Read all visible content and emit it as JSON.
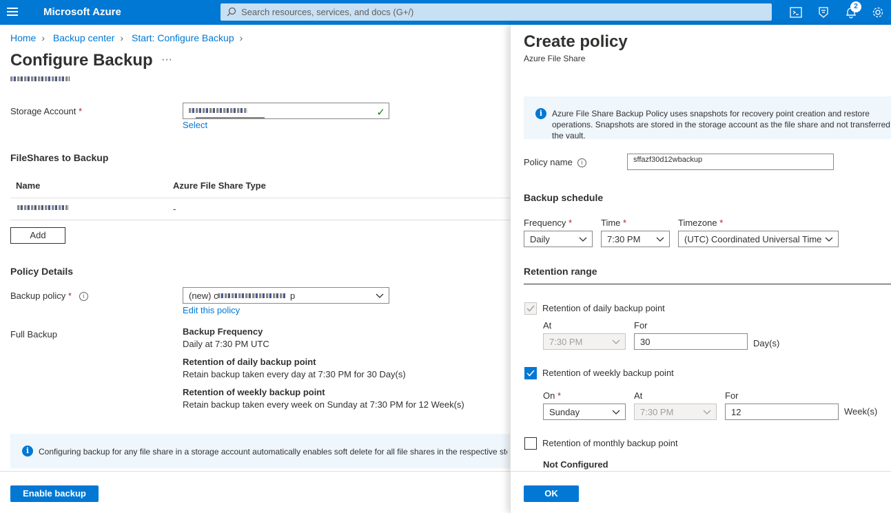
{
  "topbar": {
    "brand": "Microsoft Azure",
    "search_placeholder": "Search resources, services, and docs (G+/)",
    "notification_count": "2"
  },
  "breadcrumb": [
    "Home",
    "Backup center",
    "Start: Configure Backup"
  ],
  "page": {
    "title": "Configure Backup",
    "more": "···"
  },
  "storage": {
    "label": "Storage Account",
    "select_link": "Select"
  },
  "fileshares": {
    "heading": "FileShares to Backup",
    "col_name": "Name",
    "col_type": "Azure File Share Type",
    "row_type": "-",
    "add_button": "Add"
  },
  "policy": {
    "heading": "Policy Details",
    "label": "Backup policy",
    "value_prefix": "(new) c",
    "value_suffix": "p",
    "edit_link": "Edit this policy",
    "full_backup_label": "Full Backup",
    "details": [
      {
        "title": "Backup Frequency",
        "text": "Daily at 7:30 PM UTC"
      },
      {
        "title": "Retention of daily backup point",
        "text": "Retain backup taken every day at 7:30 PM for 30 Day(s)"
      },
      {
        "title": "Retention of weekly backup point",
        "text": "Retain backup taken every week on Sunday at 7:30 PM for 12 Week(s)"
      }
    ]
  },
  "info_bar": "Configuring backup for any file share in a storage account automatically enables soft delete for all file shares in the respective storage account.",
  "enable_button": "Enable backup",
  "panel": {
    "title": "Create policy",
    "subtitle": "Azure File Share",
    "info": "Azure File Share Backup Policy uses snapshots for recovery point creation and restore operations. Snapshots are stored in the storage account as the file share and not transferred to the vault.",
    "policy_name_label": "Policy name",
    "policy_name_value": "sffazf30d12wbackup",
    "schedule_heading": "Backup schedule",
    "frequency_label": "Frequency",
    "frequency_value": "Daily",
    "time_label": "Time",
    "time_value": "7:30 PM",
    "timezone_label": "Timezone",
    "timezone_value": "(UTC) Coordinated Universal Time",
    "retention_heading": "Retention range",
    "daily": {
      "label": "Retention of daily backup point",
      "at_label": "At",
      "at_value": "7:30 PM",
      "for_label": "For",
      "for_value": "30",
      "unit": "Day(s)",
      "checked": true
    },
    "weekly": {
      "label": "Retention of weekly backup point",
      "on_label": "On",
      "on_value": "Sunday",
      "at_label": "At",
      "at_value": "7:30 PM",
      "for_label": "For",
      "for_value": "12",
      "unit": "Week(s)",
      "checked": true
    },
    "monthly": {
      "label": "Retention of monthly backup point",
      "status": "Not Configured",
      "checked": false
    },
    "ok_button": "OK"
  }
}
